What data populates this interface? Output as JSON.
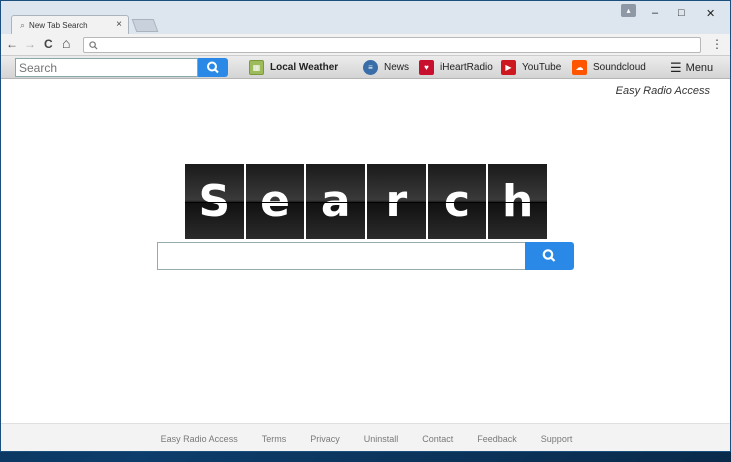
{
  "browser": {
    "tab_title": "New Tab Search",
    "tab_close": "×",
    "address_icon": "search-icon",
    "nav": {
      "back": "←",
      "forward": "→",
      "reload": "C",
      "home": "⌂"
    },
    "kebab": "⋮",
    "window_controls": {
      "minimize": "–",
      "maximize": "□",
      "close": "✕"
    }
  },
  "toolbar": {
    "search_placeholder": "Search",
    "links": [
      {
        "label": "Local Weather",
        "icon": "map-icon",
        "color": "#9dbb5a"
      },
      {
        "label": "News",
        "icon": "news-icon",
        "color": "#3a6ea8"
      },
      {
        "label": "iHeartRadio",
        "icon": "iheartradio-icon",
        "color": "#c8102e"
      },
      {
        "label": "YouTube",
        "icon": "youtube-icon",
        "color": "#cc181e"
      },
      {
        "label": "Soundcloud",
        "icon": "soundcloud-icon",
        "color": "#ff5500"
      }
    ],
    "menu_label": "Menu"
  },
  "page": {
    "brand": "Easy Radio Access",
    "logo_letters": [
      "S",
      "e",
      "a",
      "r",
      "c",
      "h"
    ]
  },
  "footer": {
    "links": [
      "Easy Radio Access",
      "Terms",
      "Privacy",
      "Uninstall",
      "Contact",
      "Feedback",
      "Support"
    ]
  },
  "colors": {
    "accent": "#2a89e6"
  }
}
